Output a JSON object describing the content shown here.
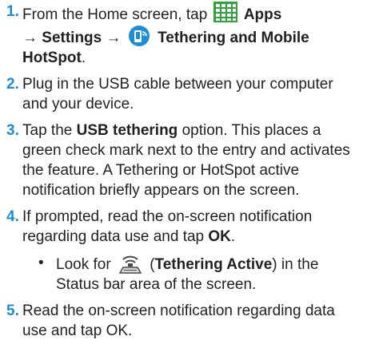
{
  "colors": {
    "accent_blue": "#1c8ed8",
    "icon_green": "#2fa33b",
    "text": "#231f20"
  },
  "steps": [
    {
      "number": "1.",
      "t1": "From the Home screen, tap",
      "icon1": "apps-grid-icon",
      "b1": "Apps",
      "t2": "→",
      "b2": "Settings →",
      "icon2": "tethering-icon",
      "b3": "Tethering and Mobile HotSpot",
      "t3": "."
    },
    {
      "number": "2.",
      "text": "Plug in the USB cable between your computer and your device."
    },
    {
      "number": "3.",
      "t1": "Tap the",
      "b1": "USB tethering",
      "t2": "option. This places a green check mark next to the entry and activates the feature. A Tethering or HotSpot active notification briefly appears on the screen."
    },
    {
      "number": "4.",
      "t1": "If prompted, read the on-screen notification regarding data use and tap",
      "b1": "OK",
      "t2": ".",
      "bullet": {
        "marker": "•",
        "t1": "Look for",
        "icon": "tethering-active-icon",
        "t2": "(",
        "b1": "Tethering Active",
        "t3": ") in the Status bar area of the screen."
      }
    },
    {
      "number": "5.",
      "text": "Read the on-screen notification regarding data use and tap OK."
    }
  ]
}
